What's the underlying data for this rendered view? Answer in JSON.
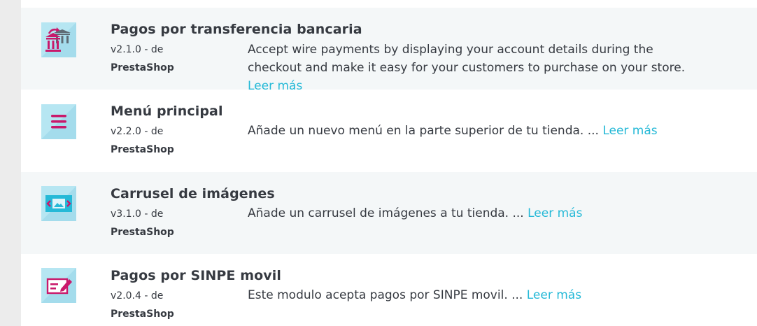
{
  "modules": [
    {
      "title": "Pagos por transferencia bancaria",
      "version": "v2.1.0 - de",
      "author": "PrestaShop",
      "description": "Accept wire payments by displaying your account details during the checkout and make it easy for your customers to purchase on your store.",
      "more_label": "Leer más",
      "icon": "bank-transfer-icon"
    },
    {
      "title": "Menú principal",
      "version": "v2.2.0 - de",
      "author": "PrestaShop",
      "description": "Añade un nuevo menú en la parte superior de tu tienda. ...",
      "more_label": "Leer más",
      "icon": "menu-icon"
    },
    {
      "title": "Carrusel de imágenes",
      "version": "v3.1.0 - de",
      "author": "PrestaShop",
      "description": "Añade un carrusel de imágenes a tu tienda. ...",
      "more_label": "Leer más",
      "icon": "image-slider-icon"
    },
    {
      "title": "Pagos por SINPE movil",
      "version": "v2.0.4 - de",
      "author": "PrestaShop",
      "description": "Este modulo acepta pagos por SINPE movil. ...",
      "more_label": "Leer más",
      "icon": "payment-card-icon"
    }
  ],
  "colors": {
    "accent": "#25b9d7",
    "icon_bg": "#b6e6f2",
    "icon_fg": "#c9196b",
    "text": "#363a41"
  }
}
